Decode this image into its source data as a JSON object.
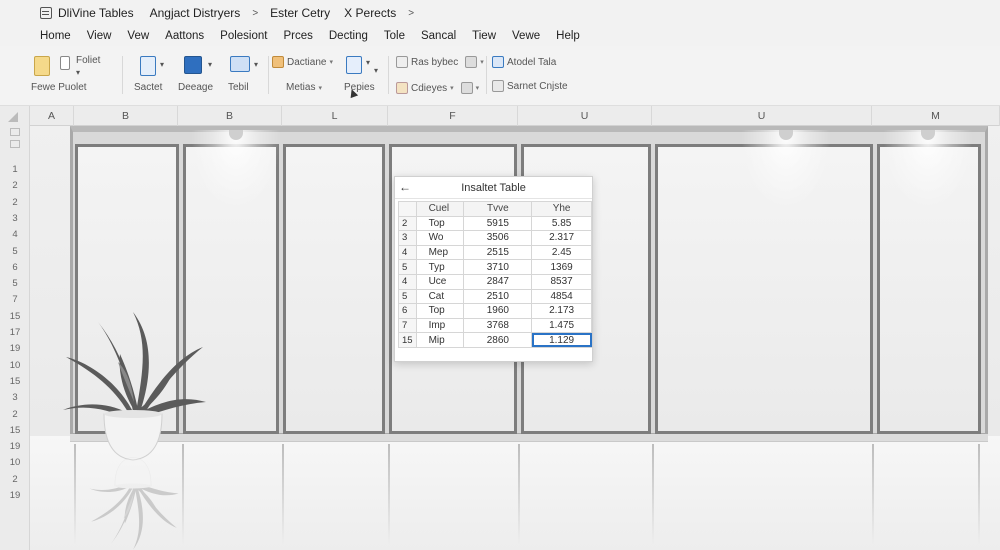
{
  "titlebar": {
    "segments": [
      "DliVine Tables",
      "Angjact Distryers",
      "Ester Cetry",
      "X Perects"
    ]
  },
  "menu": {
    "items": [
      "Home",
      "View",
      "Vew",
      "Aattons",
      "Polesiont",
      "Prces",
      "Decting",
      "Tole",
      "Sancal",
      "Tiew",
      "Vewe",
      "Help"
    ]
  },
  "ribbon": {
    "paste_top": "Foliet",
    "paste_label": "Fewe Puolet",
    "g2_label": "Sactet",
    "g3_label": "Deeage",
    "g4_label": "Tebil",
    "g5_top": "Dactiane",
    "g5_bottom": "Metias",
    "g6_label": "Pepies",
    "g7_top": "Ras bybec",
    "g7_bottom": "Cdieyes",
    "g8_top": "Atodel Tala",
    "g8_bottom": "Sarnet Cnjste",
    "icons": [
      "paste-icon",
      "music-note-icon",
      "layout-icon",
      "monitor-icon",
      "paint-icon",
      "pen-icon",
      "format-icon",
      "table-icon"
    ]
  },
  "columns": [
    "A",
    "B",
    "B",
    "L",
    "F",
    "U",
    "U",
    "M"
  ],
  "rows": [
    "1",
    "2",
    "2",
    "3",
    "4",
    "5",
    "6",
    "5",
    "7",
    "15",
    "17",
    "19",
    "10",
    "15",
    "3",
    "2",
    "15",
    "19",
    "10",
    "2",
    "19"
  ],
  "popup": {
    "title": "Insaltet Table",
    "back_icon": "back-arrow-icon",
    "headers": [
      "Cuel",
      "Tvve",
      "Yhe"
    ],
    "rows": [
      {
        "idx": "2",
        "name": "Top",
        "v1": "5915",
        "v2": "5.85"
      },
      {
        "idx": "3",
        "name": "Wo",
        "v1": "3506",
        "v2": "2.317"
      },
      {
        "idx": "4",
        "name": "Mep",
        "v1": "2515",
        "v2": "2.45"
      },
      {
        "idx": "5",
        "name": "Typ",
        "v1": "3710",
        "v2": "1369"
      },
      {
        "idx": "4",
        "name": "Uce",
        "v1": "2847",
        "v2": "8537"
      },
      {
        "idx": "5",
        "name": "Cat",
        "v1": "2510",
        "v2": "4854"
      },
      {
        "idx": "6",
        "name": "Top",
        "v1": "1960",
        "v2": "2.173"
      },
      {
        "idx": "7",
        "name": "Imp",
        "v1": "3768",
        "v2": "1.475"
      },
      {
        "idx": "15",
        "name": "Mip",
        "v1": "2860",
        "v2": "1.129"
      }
    ]
  }
}
